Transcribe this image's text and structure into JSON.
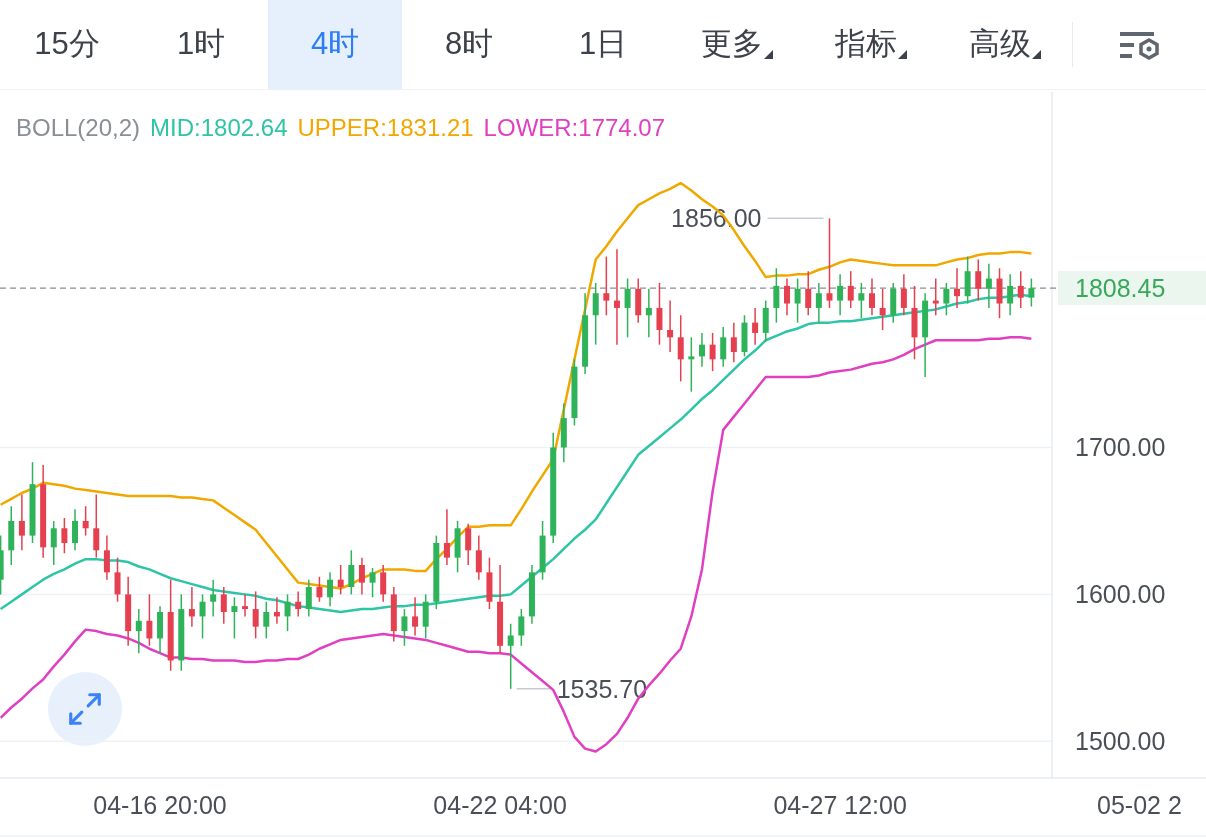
{
  "tabs": [
    {
      "label": "15分",
      "selected": false,
      "kind": "plain"
    },
    {
      "label": "1时",
      "selected": false,
      "kind": "plain"
    },
    {
      "label": "4时",
      "selected": true,
      "kind": "plain"
    },
    {
      "label": "8时",
      "selected": false,
      "kind": "plain"
    },
    {
      "label": "1日",
      "selected": false,
      "kind": "plain"
    },
    {
      "label": "更多",
      "selected": false,
      "kind": "dropdown"
    },
    {
      "label": "指标",
      "selected": false,
      "kind": "dropdown"
    },
    {
      "label": "高级",
      "selected": false,
      "kind": "dropdown"
    }
  ],
  "axis": {
    "cut_label": "05-02 2"
  },
  "chart_data": {
    "type": "candlestick",
    "title": "BOLL(20,2)",
    "ylim": [
      1475,
      1942
    ],
    "grid": true,
    "categories": [
      null,
      null,
      null,
      null,
      null,
      null,
      null,
      null,
      null,
      null,
      null,
      null,
      null,
      null,
      null,
      "04-16 20:00",
      null,
      null,
      null,
      null,
      null,
      null,
      null,
      null,
      null,
      null,
      null,
      null,
      null,
      null,
      null,
      null,
      null,
      null,
      null,
      null,
      null,
      null,
      null,
      null,
      null,
      null,
      null,
      null,
      null,
      null,
      null,
      "04-22 04:00",
      null,
      null,
      null,
      null,
      null,
      null,
      null,
      null,
      null,
      null,
      null,
      null,
      null,
      null,
      null,
      null,
      null,
      null,
      null,
      null,
      null,
      null,
      null,
      null,
      null,
      null,
      null,
      null,
      null,
      null,
      null,
      "04-27 12:00",
      null,
      null,
      null,
      null,
      null,
      null,
      null,
      null,
      null,
      null,
      null,
      null,
      null,
      null,
      null,
      null,
      null,
      null
    ],
    "yticks": [
      {
        "value": 1500,
        "label": "1500.00"
      },
      {
        "value": 1600,
        "label": "1600.00"
      },
      {
        "value": 1700,
        "label": "1700.00"
      }
    ],
    "ohlc": [
      [
        1610,
        1640,
        1600,
        1630
      ],
      [
        1630,
        1660,
        1620,
        1650
      ],
      [
        1650,
        1668,
        1630,
        1640
      ],
      [
        1640,
        1690,
        1635,
        1675
      ],
      [
        1675,
        1688,
        1625,
        1632
      ],
      [
        1632,
        1650,
        1620,
        1645
      ],
      [
        1645,
        1652,
        1628,
        1635
      ],
      [
        1635,
        1658,
        1630,
        1650
      ],
      [
        1650,
        1660,
        1640,
        1645
      ],
      [
        1645,
        1668,
        1625,
        1630
      ],
      [
        1630,
        1640,
        1610,
        1615
      ],
      [
        1615,
        1625,
        1595,
        1600
      ],
      [
        1600,
        1612,
        1565,
        1575
      ],
      [
        1575,
        1590,
        1560,
        1582
      ],
      [
        1582,
        1600,
        1565,
        1570
      ],
      [
        1570,
        1592,
        1560,
        1588
      ],
      [
        1588,
        1610,
        1548,
        1555
      ],
      [
        1555,
        1600,
        1548,
        1590
      ],
      [
        1590,
        1605,
        1578,
        1585
      ],
      [
        1585,
        1600,
        1570,
        1595
      ],
      [
        1595,
        1610,
        1585,
        1600
      ],
      [
        1600,
        1605,
        1580,
        1588
      ],
      [
        1588,
        1598,
        1570,
        1592
      ],
      [
        1592,
        1600,
        1585,
        1590
      ],
      [
        1590,
        1602,
        1570,
        1578
      ],
      [
        1578,
        1595,
        1570,
        1588
      ],
      [
        1588,
        1598,
        1580,
        1585
      ],
      [
        1585,
        1600,
        1575,
        1595
      ],
      [
        1595,
        1602,
        1585,
        1590
      ],
      [
        1590,
        1610,
        1585,
        1605
      ],
      [
        1605,
        1612,
        1595,
        1598
      ],
      [
        1598,
        1615,
        1592,
        1610
      ],
      [
        1610,
        1620,
        1600,
        1605
      ],
      [
        1605,
        1630,
        1600,
        1620
      ],
      [
        1620,
        1625,
        1600,
        1608
      ],
      [
        1608,
        1618,
        1598,
        1615
      ],
      [
        1615,
        1620,
        1595,
        1600
      ],
      [
        1600,
        1605,
        1568,
        1575
      ],
      [
        1575,
        1590,
        1565,
        1585
      ],
      [
        1585,
        1598,
        1572,
        1578
      ],
      [
        1578,
        1600,
        1570,
        1595
      ],
      [
        1595,
        1640,
        1590,
        1635
      ],
      [
        1635,
        1658,
        1620,
        1625
      ],
      [
        1625,
        1650,
        1615,
        1645
      ],
      [
        1645,
        1648,
        1620,
        1630
      ],
      [
        1630,
        1640,
        1610,
        1615
      ],
      [
        1615,
        1625,
        1590,
        1595
      ],
      [
        1595,
        1620,
        1560,
        1565
      ],
      [
        1565,
        1580,
        1535.7,
        1572
      ],
      [
        1572,
        1590,
        1565,
        1585
      ],
      [
        1585,
        1620,
        1580,
        1615
      ],
      [
        1615,
        1650,
        1610,
        1640
      ],
      [
        1640,
        1710,
        1635,
        1700
      ],
      [
        1700,
        1730,
        1690,
        1720
      ],
      [
        1720,
        1760,
        1715,
        1755
      ],
      [
        1755,
        1805,
        1750,
        1790
      ],
      [
        1790,
        1812,
        1770,
        1805
      ],
      [
        1805,
        1830,
        1790,
        1800
      ],
      [
        1800,
        1835,
        1770,
        1795
      ],
      [
        1795,
        1815,
        1775,
        1808
      ],
      [
        1808,
        1815,
        1785,
        1790
      ],
      [
        1790,
        1808,
        1775,
        1795
      ],
      [
        1795,
        1812,
        1770,
        1780
      ],
      [
        1780,
        1800,
        1765,
        1775
      ],
      [
        1775,
        1790,
        1745,
        1760
      ],
      [
        1760,
        1775,
        1738,
        1762
      ],
      [
        1762,
        1778,
        1755,
        1770
      ],
      [
        1770,
        1778,
        1752,
        1760
      ],
      [
        1760,
        1782,
        1755,
        1775
      ],
      [
        1775,
        1785,
        1758,
        1765
      ],
      [
        1765,
        1790,
        1762,
        1785
      ],
      [
        1785,
        1795,
        1770,
        1778
      ],
      [
        1778,
        1800,
        1772,
        1795
      ],
      [
        1795,
        1822,
        1785,
        1810
      ],
      [
        1810,
        1815,
        1790,
        1798
      ],
      [
        1798,
        1815,
        1785,
        1808
      ],
      [
        1808,
        1820,
        1790,
        1795
      ],
      [
        1795,
        1812,
        1785,
        1805
      ],
      [
        1805,
        1856,
        1795,
        1800
      ],
      [
        1800,
        1818,
        1790,
        1810
      ],
      [
        1810,
        1820,
        1795,
        1800
      ],
      [
        1800,
        1812,
        1788,
        1805
      ],
      [
        1805,
        1815,
        1790,
        1795
      ],
      [
        1795,
        1808,
        1780,
        1790
      ],
      [
        1790,
        1812,
        1785,
        1808
      ],
      [
        1808,
        1818,
        1790,
        1795
      ],
      [
        1795,
        1810,
        1760,
        1775
      ],
      [
        1775,
        1805,
        1748,
        1800
      ],
      [
        1800,
        1815,
        1790,
        1798
      ],
      [
        1798,
        1812,
        1790,
        1808
      ],
      [
        1808,
        1822,
        1795,
        1803
      ],
      [
        1803,
        1830,
        1798,
        1820
      ],
      [
        1820,
        1828,
        1800,
        1808
      ],
      [
        1808,
        1825,
        1795,
        1815
      ],
      [
        1815,
        1822,
        1788,
        1798
      ],
      [
        1798,
        1818,
        1790,
        1810
      ],
      [
        1810,
        1820,
        1795,
        1802
      ],
      [
        1802,
        1815,
        1796,
        1808.45
      ]
    ],
    "series": [
      {
        "name": "MID:1802.64",
        "type": "line",
        "color": "#2ec4a6",
        "values": [
          1590,
          1595,
          1600,
          1605,
          1610,
          1614,
          1617,
          1621,
          1624,
          1624,
          1623,
          1623,
          1622,
          1619,
          1617,
          1614,
          1611,
          1609,
          1607,
          1605,
          1603,
          1602,
          1601,
          1600,
          1599,
          1597,
          1596,
          1594,
          1592,
          1591,
          1590,
          1589,
          1588,
          1589,
          1590,
          1590,
          1591,
          1592,
          1592,
          1593,
          1593,
          1594,
          1595,
          1596,
          1597,
          1598,
          1599,
          1599,
          1600,
          1606,
          1612,
          1618,
          1624,
          1631,
          1638,
          1644,
          1651,
          1662,
          1673,
          1684,
          1695,
          1701,
          1707,
          1713,
          1719,
          1726,
          1733,
          1739,
          1746,
          1753,
          1760,
          1766,
          1773,
          1776,
          1779,
          1781,
          1784,
          1785,
          1785,
          1786,
          1786,
          1787,
          1788,
          1789,
          1790,
          1791,
          1792,
          1793,
          1794,
          1796,
          1798,
          1799,
          1801,
          1802,
          1802,
          1803,
          1804,
          1803
        ]
      },
      {
        "name": "UPPER:1831.21",
        "type": "line",
        "color": "#f0a800",
        "values": [
          1661,
          1665,
          1669,
          1672,
          1676,
          1675,
          1674,
          1672,
          1671,
          1670,
          1669,
          1668,
          1667,
          1667,
          1667,
          1667,
          1667,
          1666,
          1666,
          1665,
          1664,
          1659,
          1654,
          1649,
          1644,
          1635,
          1626,
          1617,
          1608,
          1607,
          1606,
          1605,
          1604,
          1607,
          1611,
          1614,
          1617,
          1617,
          1617,
          1616,
          1616,
          1624,
          1631,
          1639,
          1646,
          1646,
          1647,
          1647,
          1647,
          1658,
          1670,
          1681,
          1692,
          1726,
          1760,
          1794,
          1828,
          1837,
          1847,
          1856,
          1865,
          1869,
          1873,
          1876,
          1880,
          1875,
          1869,
          1864,
          1858,
          1848,
          1837,
          1827,
          1816,
          1817,
          1817,
          1818,
          1818,
          1821,
          1823,
          1826,
          1828,
          1827,
          1826,
          1825,
          1824,
          1824,
          1824,
          1824,
          1824,
          1826,
          1828,
          1829,
          1831,
          1832,
          1832,
          1833,
          1833,
          1832
        ]
      },
      {
        "name": "LOWER:1774.07",
        "type": "line",
        "color": "#e040c0",
        "values": [
          1516,
          1523,
          1529,
          1536,
          1542,
          1551,
          1559,
          1568,
          1576,
          1575,
          1573,
          1572,
          1570,
          1567,
          1563,
          1560,
          1557,
          1557,
          1556,
          1556,
          1555,
          1555,
          1555,
          1554,
          1554,
          1555,
          1555,
          1556,
          1556,
          1559,
          1563,
          1566,
          1569,
          1570,
          1571,
          1572,
          1573,
          1572,
          1571,
          1570,
          1569,
          1567,
          1565,
          1563,
          1561,
          1561,
          1560,
          1560,
          1559,
          1553,
          1547,
          1541,
          1535,
          1520,
          1503,
          1495,
          1493,
          1498,
          1505,
          1516,
          1529,
          1538,
          1546,
          1555,
          1563,
          1585,
          1617,
          1670,
          1712,
          1721,
          1730,
          1739,
          1748,
          1748,
          1748,
          1748,
          1748,
          1749,
          1751,
          1752,
          1753,
          1755,
          1757,
          1758,
          1760,
          1763,
          1767,
          1770,
          1773,
          1773,
          1773,
          1773,
          1773,
          1774,
          1774,
          1775,
          1775,
          1774
        ]
      }
    ],
    "annotations": [
      "1856.00",
      "1535.70"
    ],
    "ref_lines": [
      {
        "axis": "y",
        "value": 1808.45,
        "label": "1808.45"
      }
    ]
  }
}
